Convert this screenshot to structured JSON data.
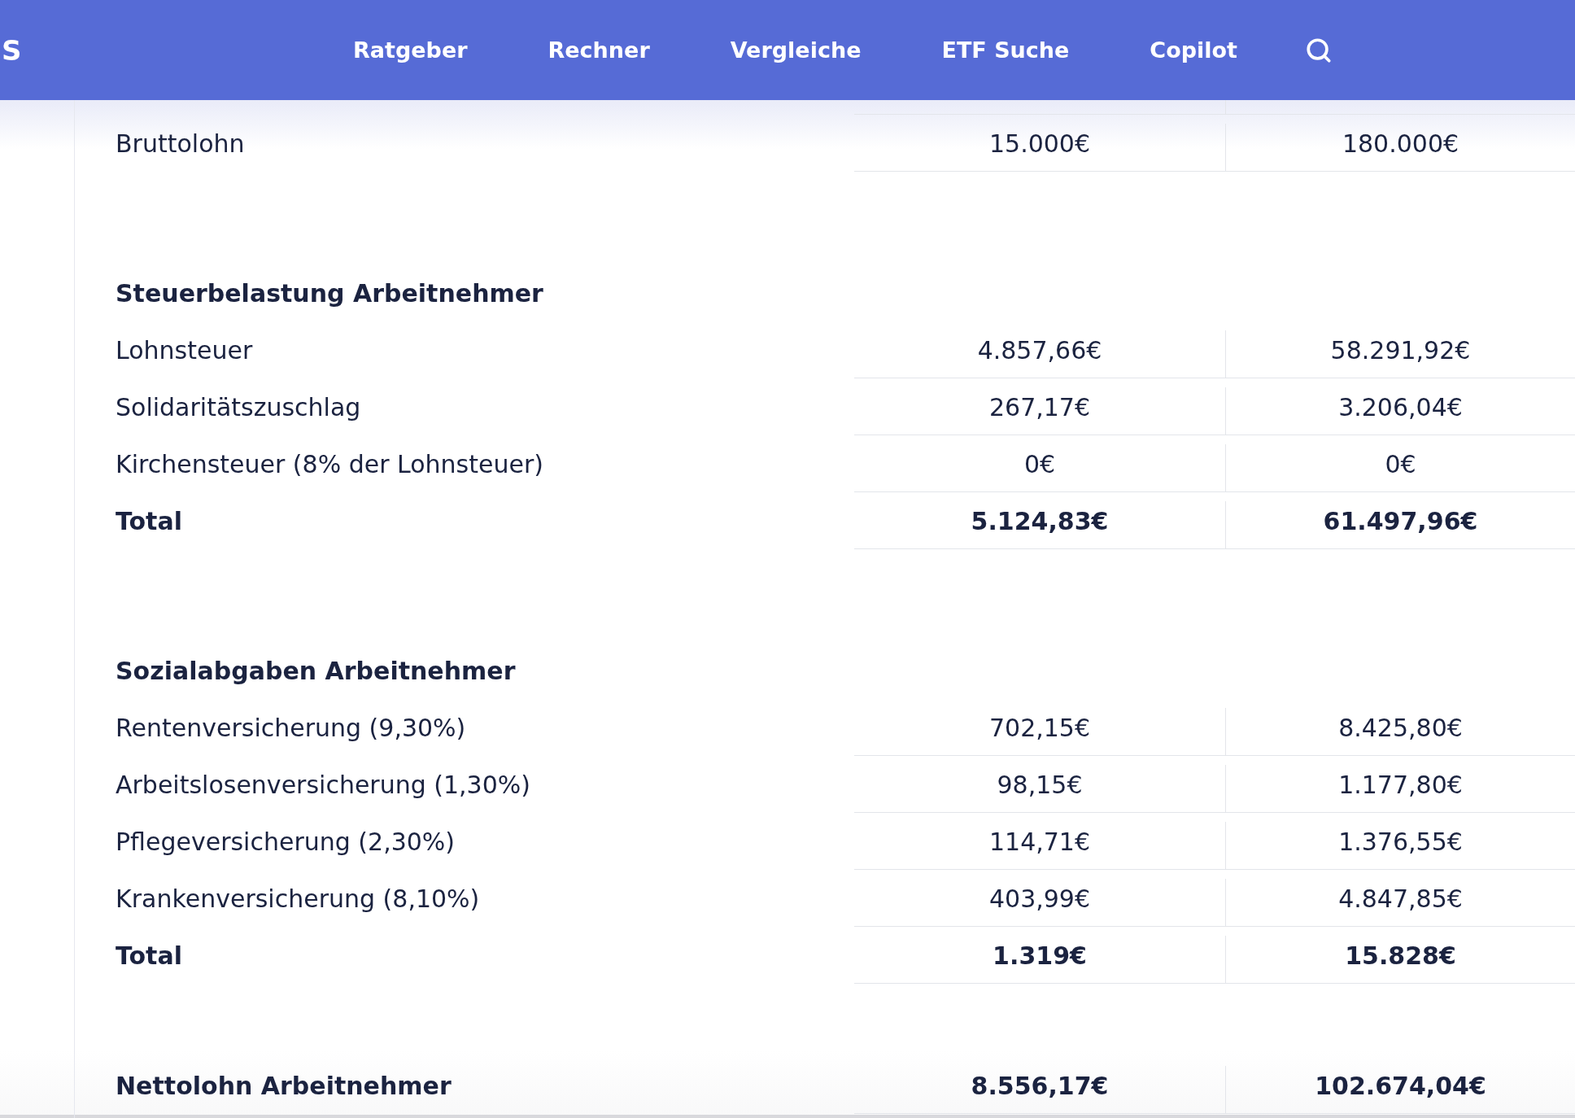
{
  "header": {
    "logo_text": "S",
    "nav": [
      "Ratgeber",
      "Rechner",
      "Vergleiche",
      "ETF Suche",
      "Copilot"
    ]
  },
  "gross": {
    "label": "Bruttolohn",
    "monthly": "15.000€",
    "yearly": "180.000€"
  },
  "sections": [
    {
      "title": "Steuerbelastung Arbeitnehmer",
      "rows": [
        {
          "label": "Lohnsteuer",
          "monthly": "4.857,66€",
          "yearly": "58.291,92€"
        },
        {
          "label": "Solidaritätszuschlag",
          "monthly": "267,17€",
          "yearly": "3.206,04€"
        },
        {
          "label": "Kirchensteuer (8% der Lohnsteuer)",
          "monthly": "0€",
          "yearly": "0€"
        }
      ],
      "total": {
        "label": "Total",
        "monthly": "5.124,83€",
        "yearly": "61.497,96€"
      }
    },
    {
      "title": "Sozialabgaben Arbeitnehmer",
      "rows": [
        {
          "label": "Rentenversicherung (9,30%)",
          "monthly": "702,15€",
          "yearly": "8.425,80€"
        },
        {
          "label": "Arbeitslosenversicherung (1,30%)",
          "monthly": "98,15€",
          "yearly": "1.177,80€"
        },
        {
          "label": "Pflegeversicherung (2,30%)",
          "monthly": "114,71€",
          "yearly": "1.376,55€"
        },
        {
          "label": "Krankenversicherung (8,10%)",
          "monthly": "403,99€",
          "yearly": "4.847,85€"
        }
      ],
      "total": {
        "label": "Total",
        "monthly": "1.319€",
        "yearly": "15.828€"
      }
    }
  ],
  "net": {
    "label": "Nettolohn Arbeitnehmer",
    "monthly": "8.556,17€",
    "yearly": "102.674,04€"
  }
}
